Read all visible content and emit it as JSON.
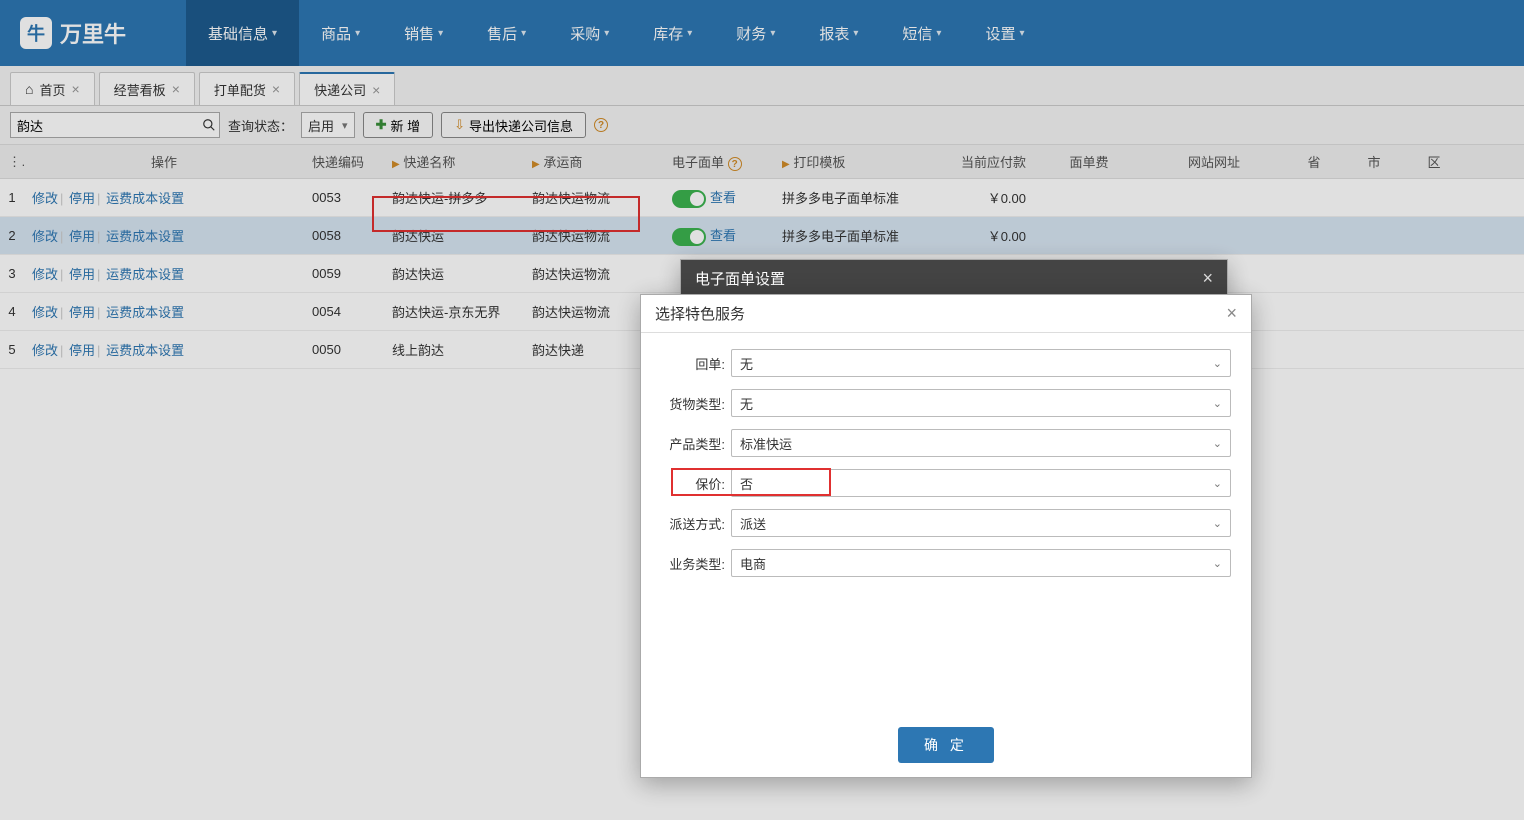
{
  "logo": "万里牛",
  "nav": [
    {
      "label": "基础信息",
      "active": true
    },
    {
      "label": "商品"
    },
    {
      "label": "销售"
    },
    {
      "label": "售后"
    },
    {
      "label": "采购"
    },
    {
      "label": "库存"
    },
    {
      "label": "财务"
    },
    {
      "label": "报表"
    },
    {
      "label": "短信"
    },
    {
      "label": "设置"
    }
  ],
  "tabs": [
    {
      "label": "首页",
      "home": true
    },
    {
      "label": "经营看板"
    },
    {
      "label": "打单配货"
    },
    {
      "label": "快递公司",
      "active": true
    }
  ],
  "toolbar": {
    "search_value": "韵达",
    "query_status_label": "查询状态：",
    "query_status_value": "启用",
    "add_label": "新 增",
    "export_label": "导出快递公司信息"
  },
  "columns": {
    "ops": "操作",
    "code": "快递编码",
    "name": "快递名称",
    "carrier": "承运商",
    "ebill": "电子面单",
    "tpl": "打印模板",
    "cod": "当前应付款",
    "billfee": "面单费",
    "url": "网站网址",
    "prov": "省",
    "city": "市",
    "dist": "区"
  },
  "ops": {
    "edit": "修改",
    "disable": "停用",
    "cost": "运费成本设置"
  },
  "ebill_view": "查看",
  "rows": [
    {
      "idx": "1",
      "code": "0053",
      "name": "韵达快运-拼多多",
      "carrier": "韵达快运物流",
      "ebill": true,
      "tpl": "拼多多电子面单标准",
      "cod": "￥0.00",
      "selected": false
    },
    {
      "idx": "2",
      "code": "0058",
      "name": "韵达快运",
      "carrier": "韵达快运物流",
      "ebill": true,
      "tpl": "拼多多电子面单标准",
      "cod": "￥0.00",
      "selected": true
    },
    {
      "idx": "3",
      "code": "0059",
      "name": "韵达快运",
      "carrier": "韵达快运物流",
      "ebill": false,
      "tpl": "",
      "cod": "",
      "selected": false
    },
    {
      "idx": "4",
      "code": "0054",
      "name": "韵达快运-京东无界",
      "carrier": "韵达快运物流",
      "ebill": false,
      "tpl": "",
      "cod": "",
      "selected": false
    },
    {
      "idx": "5",
      "code": "0050",
      "name": "线上韵达",
      "carrier": "韵达快递",
      "ebill": false,
      "tpl": "",
      "cod": "",
      "selected": false
    }
  ],
  "dialog_back": {
    "title": "电子面单设置"
  },
  "dialog_front": {
    "title": "选择特色服务",
    "fields": [
      {
        "label": "回单:",
        "value": "无"
      },
      {
        "label": "货物类型:",
        "value": "无"
      },
      {
        "label": "产品类型:",
        "value": "标准快运"
      },
      {
        "label": "保价:",
        "value": "否",
        "highlight": true
      },
      {
        "label": "派送方式:",
        "value": "派送"
      },
      {
        "label": "业务类型:",
        "value": "电商"
      }
    ],
    "confirm": "确 定"
  }
}
